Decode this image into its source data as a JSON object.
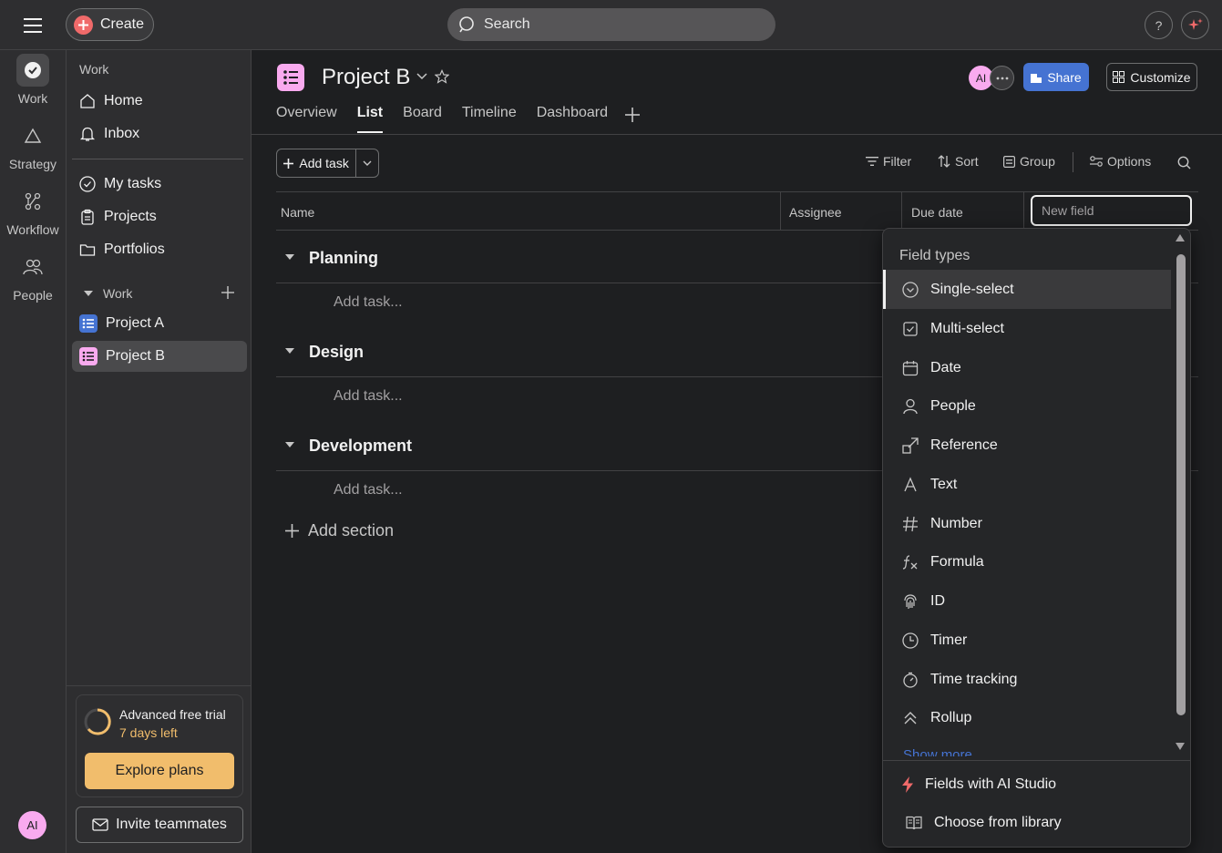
{
  "topbar": {
    "create_label": "Create",
    "search_placeholder": "Search",
    "help_label": "?"
  },
  "rail": {
    "items": [
      {
        "label": "Work",
        "icon": "check-circle-icon"
      },
      {
        "label": "Strategy",
        "icon": "triangle-icon"
      },
      {
        "label": "Workflow",
        "icon": "workflow-icon"
      },
      {
        "label": "People",
        "icon": "people-icon"
      }
    ],
    "avatar_initials": "AI"
  },
  "sidebar": {
    "heading": "Work",
    "home": "Home",
    "inbox": "Inbox",
    "my_tasks": "My tasks",
    "projects": "Projects",
    "portfolios": "Portfolios",
    "work_section": "Work",
    "project_a": "Project A",
    "project_b": "Project B",
    "trial_title": "Advanced free trial",
    "trial_days": "7 days left",
    "explore_label": "Explore plans",
    "invite_label": "Invite teammates"
  },
  "project": {
    "title": "Project B",
    "tabs": [
      "Overview",
      "List",
      "Board",
      "Timeline",
      "Dashboard"
    ],
    "active_tab": "List",
    "avatar_initials": "AI",
    "share_label": "Share",
    "customize_label": "Customize"
  },
  "toolbar": {
    "add_task": "Add task",
    "filter": "Filter",
    "sort": "Sort",
    "group": "Group",
    "options": "Options"
  },
  "columns": {
    "name": "Name",
    "assignee": "Assignee",
    "due_date": "Due date",
    "new_field_placeholder": "New field"
  },
  "sections": [
    {
      "title": "Planning",
      "add_task": "Add task..."
    },
    {
      "title": "Design",
      "add_task": "Add task..."
    },
    {
      "title": "Development",
      "add_task": "Add task..."
    }
  ],
  "add_section_label": "Add section",
  "dropdown": {
    "header": "Field types",
    "items": [
      {
        "label": "Single-select",
        "icon": "single-select-icon"
      },
      {
        "label": "Multi-select",
        "icon": "multi-select-icon"
      },
      {
        "label": "Date",
        "icon": "calendar-icon"
      },
      {
        "label": "People",
        "icon": "person-icon"
      },
      {
        "label": "Reference",
        "icon": "reference-icon"
      },
      {
        "label": "Text",
        "icon": "text-icon"
      },
      {
        "label": "Number",
        "icon": "hash-icon"
      },
      {
        "label": "Formula",
        "icon": "formula-icon"
      },
      {
        "label": "ID",
        "icon": "fingerprint-icon"
      },
      {
        "label": "Timer",
        "icon": "clock-icon"
      },
      {
        "label": "Time tracking",
        "icon": "stopwatch-icon"
      },
      {
        "label": "Rollup",
        "icon": "rollup-icon"
      }
    ],
    "show_more": "Show more",
    "ai_studio": "Fields with AI Studio",
    "library": "Choose from library"
  },
  "colors": {
    "accent_blue": "#4573d2",
    "create_red": "#f06a6a",
    "project_a": "#4573d2",
    "project_b": "#f9aaef",
    "trial_orange": "#f1bd6c"
  }
}
